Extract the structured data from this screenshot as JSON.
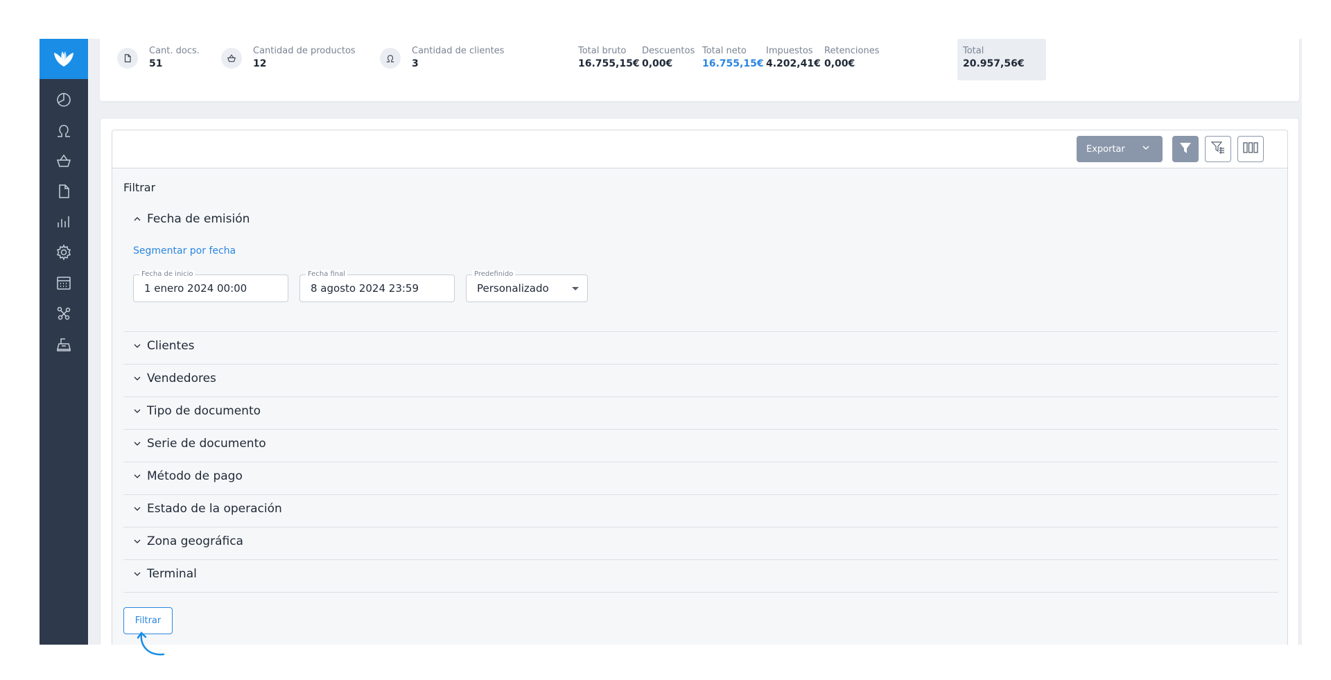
{
  "sidebar": {
    "logo_icon": "leaf-logo",
    "items": [
      {
        "icon": "pie-chart-icon"
      },
      {
        "icon": "user-icon"
      },
      {
        "icon": "basket-icon"
      },
      {
        "icon": "document-icon"
      },
      {
        "icon": "bar-chart-icon"
      },
      {
        "icon": "gear-icon"
      },
      {
        "icon": "calendar-icon"
      },
      {
        "icon": "connections-icon"
      },
      {
        "icon": "cash-register-icon"
      }
    ]
  },
  "stats": {
    "docs": {
      "label": "Cant. docs.",
      "value": "51"
    },
    "products": {
      "label": "Cantidad de productos",
      "value": "12"
    },
    "clients": {
      "label": "Cantidad de clientes",
      "value": "3"
    },
    "gross": {
      "label": "Total bruto",
      "value": "16.755,15€"
    },
    "discounts": {
      "label": "Descuentos",
      "value": "0,00€"
    },
    "net": {
      "label": "Total neto",
      "value": "16.755,15€"
    },
    "taxes": {
      "label": "Impuestos",
      "value": "4.202,41€"
    },
    "withholdings": {
      "label": "Retenciones",
      "value": "0,00€"
    },
    "total": {
      "label": "Total",
      "value": "20.957,56€"
    }
  },
  "toolbar": {
    "export_label": "Exportar"
  },
  "filter": {
    "title": "Filtrar",
    "date_section": {
      "title": "Fecha de emisión",
      "segment_link": "Segmentar por fecha",
      "start": {
        "label": "Fecha de inicio",
        "value": "1 enero 2024 00:00"
      },
      "end": {
        "label": "Fecha final",
        "value": "8 agosto 2024 23:59"
      },
      "preset": {
        "label": "Predefinido",
        "value": "Personalizado"
      }
    },
    "sections": [
      "Clientes",
      "Vendedores",
      "Tipo de documento",
      "Serie de documento",
      "Método de pago",
      "Estado de la operación",
      "Zona geográfica",
      "Terminal"
    ],
    "submit_label": "Filtrar"
  },
  "colors": {
    "sidebar_bg": "#2e3a4b",
    "logo_bg": "#1a8de6",
    "accent": "#2b86e0",
    "toolbar_button": "#8a97aa"
  }
}
